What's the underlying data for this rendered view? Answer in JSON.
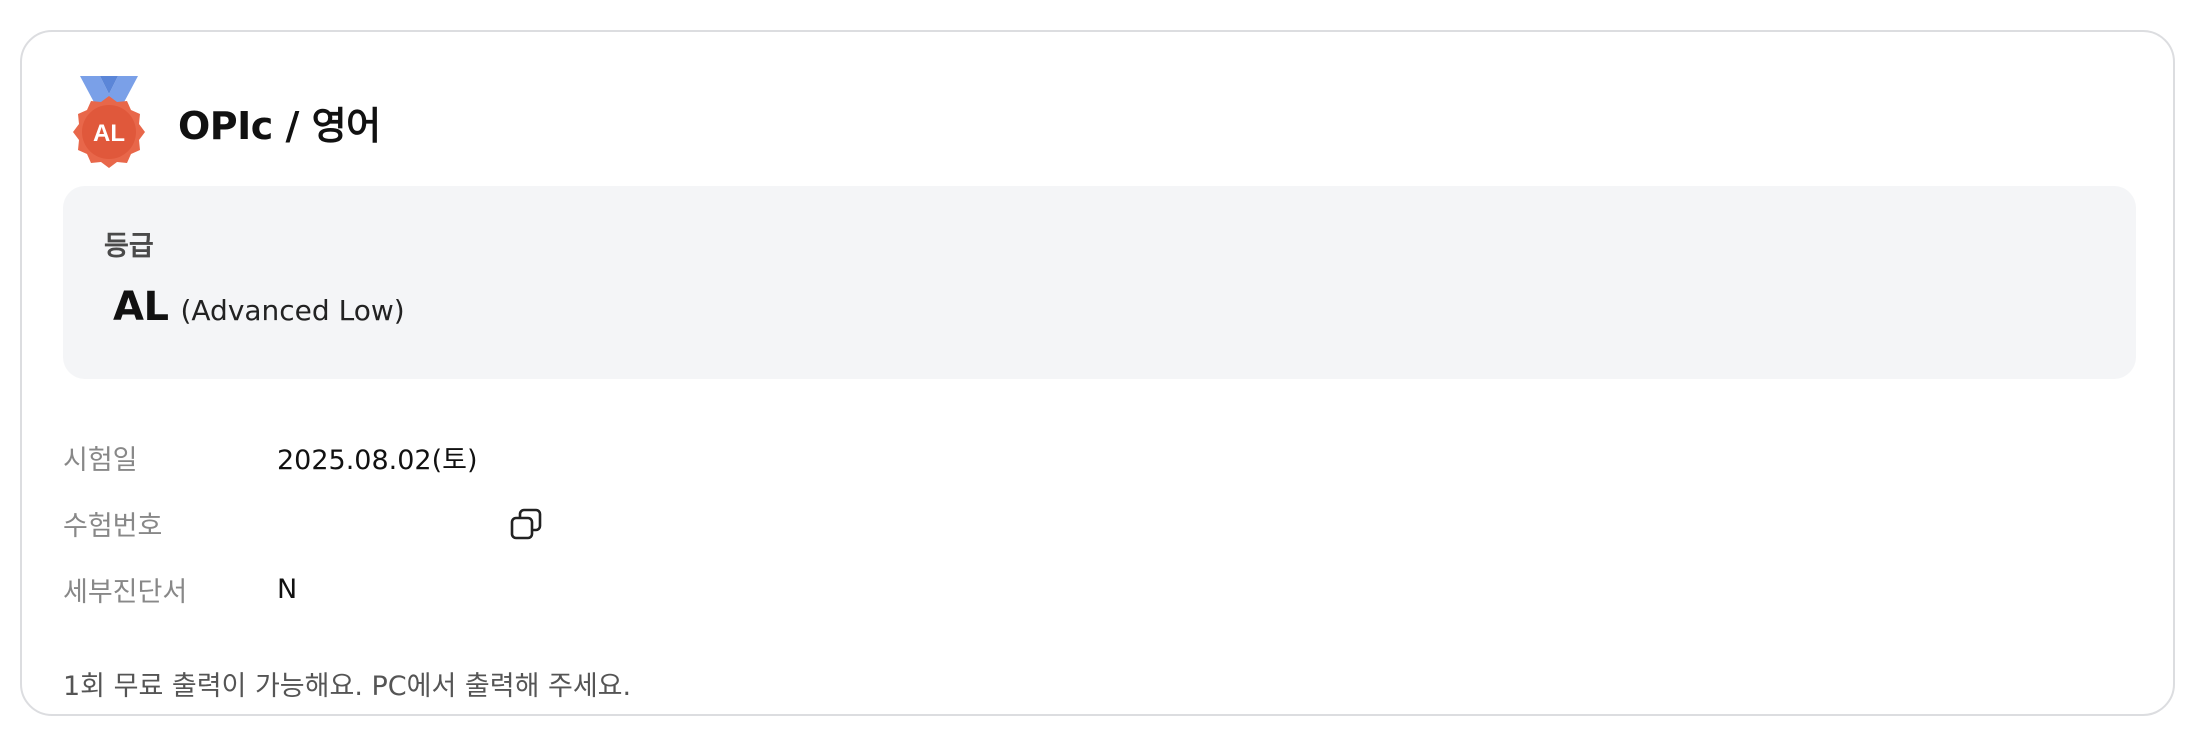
{
  "header": {
    "badge_text": "AL",
    "title": "OPIc / 영어"
  },
  "grade": {
    "label": "등급",
    "code": "AL",
    "name": "(Advanced Low)"
  },
  "info": {
    "rows": [
      {
        "label": "시험일",
        "value": "2025.08.02(토)"
      },
      {
        "label": "수험번호",
        "value": ""
      },
      {
        "label": "세부진단서",
        "value": "N"
      }
    ]
  },
  "notice": "1회 무료 출력이 가능해요. PC에서 출력해 주세요.",
  "colors": {
    "medal": "#e8674a",
    "ribbon": "#7aa0e8",
    "grade_bg": "#f4f5f7",
    "border": "#dcdde0"
  },
  "icons": {
    "medal": "medal-icon",
    "copy": "copy-icon"
  }
}
